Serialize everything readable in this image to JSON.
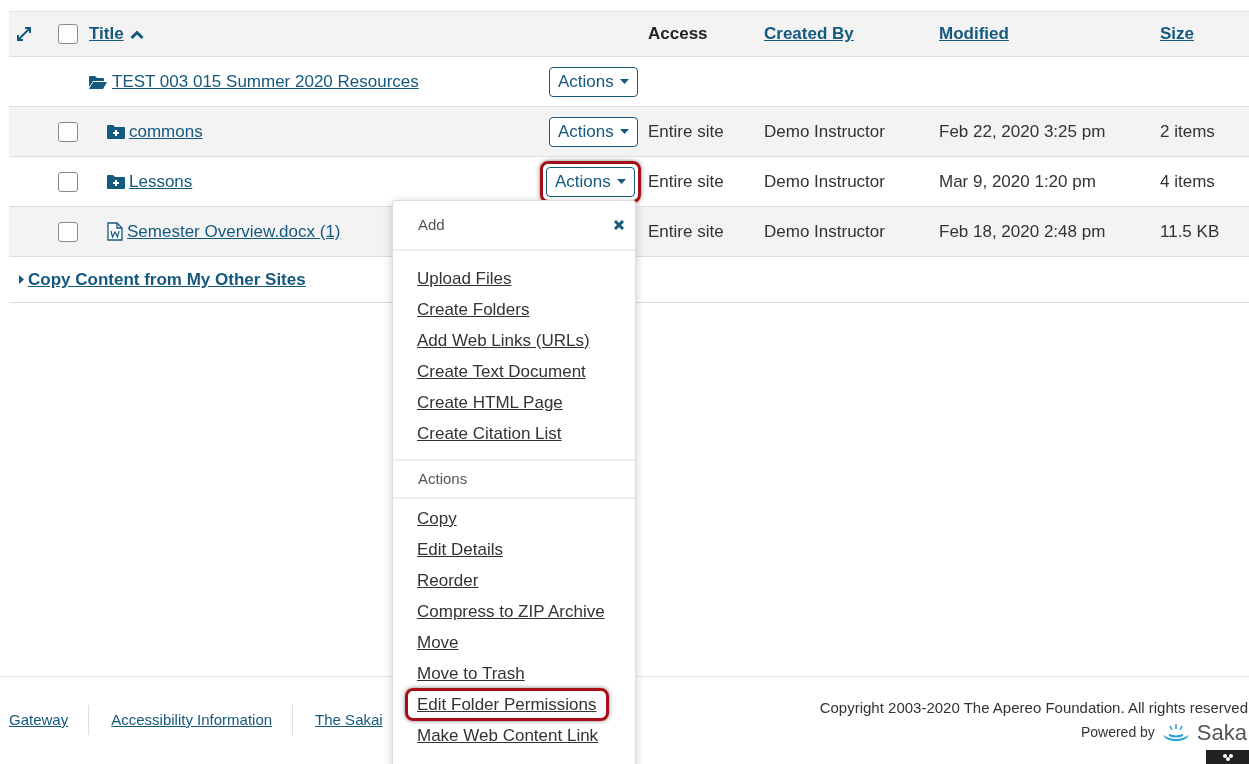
{
  "table": {
    "columns": [
      {
        "label": "Title",
        "kind": "sort-link",
        "sorted_ascending": true
      },
      {
        "label": "Access",
        "kind": "plain"
      },
      {
        "label": "Created By",
        "kind": "link"
      },
      {
        "label": "Modified",
        "kind": "link"
      },
      {
        "label": "Size",
        "kind": "link"
      }
    ],
    "select_all_checked": false,
    "root": {
      "title": "TEST 003 015 Summer 2020 Resources",
      "kind": "open-folder",
      "actions": {
        "label": "Actions",
        "highlighted": false
      },
      "children": [
        {
          "title": "commons",
          "kind": "folder",
          "checked": false,
          "actions": {
            "label": "Actions",
            "highlighted": false
          },
          "access": "Entire site",
          "created_by": "Demo Instructor",
          "modified": "Feb 22, 2020 3:25 pm",
          "size": "2 items"
        },
        {
          "title": "Lessons",
          "kind": "folder",
          "checked": false,
          "actions": {
            "label": "Actions",
            "highlighted": true
          },
          "access": "Entire site",
          "created_by": "Demo Instructor",
          "modified": "Mar 9, 2020 1:20 pm",
          "size": "4 items"
        },
        {
          "title": "Semester Overview.docx (1)",
          "kind": "document",
          "checked": false,
          "access": "Entire site",
          "created_by": "Demo Instructor",
          "modified": "Feb 18, 2020 2:48 pm",
          "size": "11.5 KB"
        }
      ]
    }
  },
  "copy_link": "Copy Content from My Other Sites",
  "menu": {
    "sections": [
      {
        "title": "Add",
        "items": [
          {
            "label": "Upload Files",
            "highlighted": false
          },
          {
            "label": "Create Folders",
            "highlighted": false
          },
          {
            "label": "Add Web Links (URLs)",
            "highlighted": false
          },
          {
            "label": "Create Text Document",
            "highlighted": false
          },
          {
            "label": "Create HTML Page",
            "highlighted": false
          },
          {
            "label": "Create Citation List",
            "highlighted": false
          }
        ]
      },
      {
        "title": "Actions",
        "items": [
          {
            "label": "Copy",
            "highlighted": false
          },
          {
            "label": "Edit Details",
            "highlighted": false
          },
          {
            "label": "Reorder",
            "highlighted": false
          },
          {
            "label": "Compress to ZIP Archive",
            "highlighted": false
          },
          {
            "label": "Move",
            "highlighted": false
          },
          {
            "label": "Move to Trash",
            "highlighted": false
          },
          {
            "label": "Edit Folder Permissions",
            "highlighted": true
          },
          {
            "label": "Make Web Content Link",
            "highlighted": false
          }
        ]
      }
    ]
  },
  "footer": {
    "links": [
      "Gateway",
      "Accessibility Information",
      "The Sakai"
    ],
    "copyright": "Copyright 2003-2020 The Apereo Foundation. All rights reserved",
    "powered_by": "Powered by",
    "logo_text": "Saka"
  }
}
